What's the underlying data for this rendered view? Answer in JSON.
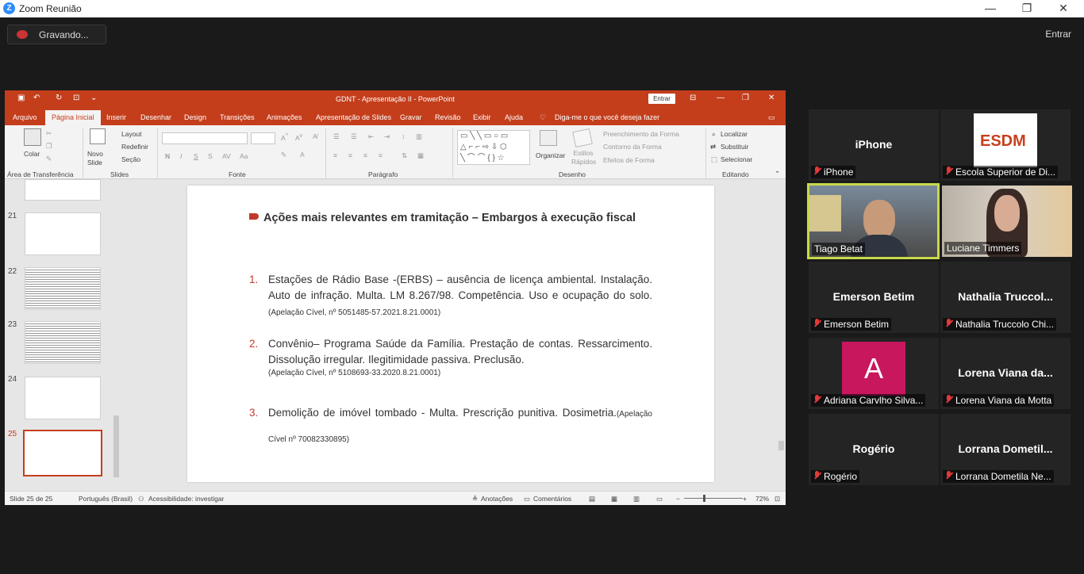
{
  "zoom": {
    "title": "Zoom Reunião",
    "recording_label": "Gravando...",
    "enter_label": "Entrar",
    "minimize": "—",
    "restore": "❐",
    "close": "✕"
  },
  "powerpoint": {
    "title": "GDNT - Apresentação II  -  PowerPoint",
    "enter_label": "Entrar",
    "tabs": [
      "Arquivo",
      "Página Inicial",
      "Inserir",
      "Desenhar",
      "Design",
      "Transições",
      "Animações",
      "Apresentação de Slides",
      "Gravar",
      "Revisão",
      "Exibir",
      "Ajuda"
    ],
    "tell_me": "Diga-me o que você deseja fazer",
    "ribbon": {
      "colar": "Colar",
      "area_transferencia": "Área de Transferência",
      "novo_slide": "Novo Slide",
      "layout": "Layout",
      "redefinir": "Redefinir",
      "secao": "Seção",
      "slides": "Slides",
      "fonte": "Fonte",
      "paragrafo": "Parágrafo",
      "organizar": "Organizar",
      "estilos_rapidos": "Estilos Rápidos",
      "preenchimento": "Preenchimento da Forma",
      "contorno": "Contorno da Forma",
      "efeitos": "Efeitos de Forma",
      "desenho": "Desenho",
      "localizar": "Localizar",
      "substituir": "Substituir",
      "selecionar": "Selecionar",
      "editando": "Editando"
    },
    "thumbnails": [
      {
        "num": "21"
      },
      {
        "num": "22"
      },
      {
        "num": "23"
      },
      {
        "num": "24"
      },
      {
        "num": "25"
      }
    ],
    "slide": {
      "heading": "Ações mais relevantes em tramitação – Embargos à execução fiscal",
      "items": [
        {
          "num": "1.",
          "text": "Estações de Rádio Base -(ERBS) – ausência de licença ambiental. Instalação. Auto de infração. Multa. LM 8.267/98. Competência. Uso e ocupação do solo.",
          "ref": "(Apelação Cível, nº 5051485-57.2021.8.21.0001)"
        },
        {
          "num": "2.",
          "text": "Convênio– Programa Saúde da Família. Prestação de contas. Ressarcimento. Dissolução irregular. Ilegitimidade passiva. Preclusão.",
          "ref": "(Apelação Cível, nº 5108693-33.2020.8.21.0001)"
        },
        {
          "num": "3.",
          "text": "Demolição de imóvel tombado - Multa. Prescrição punitiva. Dosimetria.",
          "ref": "(Apelação Cível nº 70082330895)"
        }
      ]
    },
    "status": {
      "slide_count": "Slide 25 de 25",
      "language": "Português (Brasil)",
      "accessibility": "Acessibilidade: investigar",
      "notes": "Anotações",
      "comments": "Comentários",
      "zoom": "72%"
    }
  },
  "participants": [
    {
      "big": "iPhone",
      "label": "iPhone"
    },
    {
      "big": "",
      "label": "Escola Superior de Di...",
      "logo": "ESDM"
    },
    {
      "big": "",
      "label": "Tiago Betat"
    },
    {
      "big": "",
      "label": "Luciane Timmers"
    },
    {
      "big": "Emerson Betim",
      "label": "Emerson Betim"
    },
    {
      "big": "Nathalia  Truccol...",
      "label": "Nathalia Truccolo Chi..."
    },
    {
      "big": "A",
      "label": "Adriana Carvlho Silva..."
    },
    {
      "big": "Lorena Viana da...",
      "label": "Lorena Viana da Motta"
    },
    {
      "big": "Rogério",
      "label": "Rogério"
    },
    {
      "big": "Lorrana  Dometil...",
      "label": "Lorrana Dometila Ne..."
    }
  ],
  "colors": {
    "accent": "#c43e1c",
    "active_speaker": "#c8d94a",
    "avatar": "#c8175d",
    "mic_muted": "#e03a3a"
  }
}
